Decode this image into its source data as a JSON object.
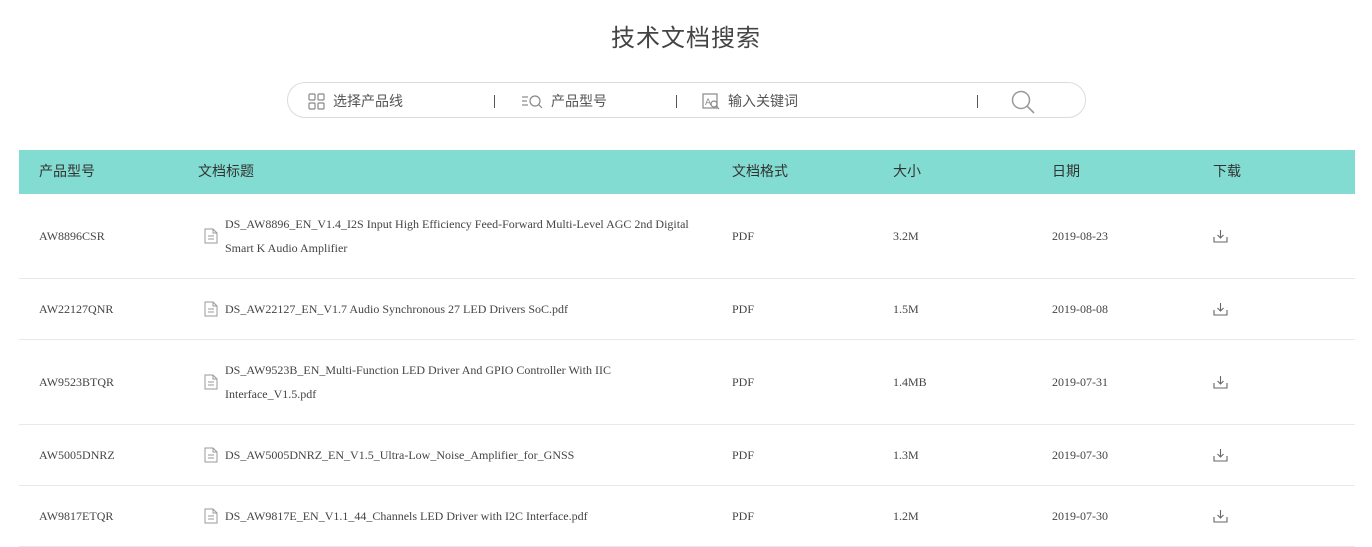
{
  "page": {
    "title": "技术文档搜索"
  },
  "search": {
    "product_line_label": "选择产品线",
    "model_label": "产品型号",
    "keyword_placeholder": "输入关键词",
    "product_line_icon": "grid-icon",
    "model_icon": "list-search-icon",
    "keyword_icon": "text-search-icon",
    "search_icon": "magnifier-icon"
  },
  "table": {
    "header_color": "#82dcd2",
    "columns": [
      "产品型号",
      "文档标题",
      "文档格式",
      "大小",
      "日期",
      "下载"
    ],
    "rows": [
      {
        "model": "AW8896CSR",
        "title": "DS_AW8896_EN_V1.4_I2S Input High Efficiency Feed-Forward Multi-Level AGC 2nd Digital Smart K Audio Amplifier",
        "format": "PDF",
        "size": "3.2M",
        "date": "2019-08-23"
      },
      {
        "model": "AW22127QNR",
        "title": "DS_AW22127_EN_V1.7 Audio Synchronous 27 LED Drivers SoC.pdf",
        "format": "PDF",
        "size": "1.5M",
        "date": "2019-08-08"
      },
      {
        "model": "AW9523BTQR",
        "title": "DS_AW9523B_EN_Multi-Function LED Driver And GPIO Controller With IIC Interface_V1.5.pdf",
        "format": "PDF",
        "size": "1.4MB",
        "date": "2019-07-31"
      },
      {
        "model": "AW5005DNRZ",
        "title": "DS_AW5005DNRZ_EN_V1.5_Ultra-Low_Noise_Amplifier_for_GNSS",
        "format": "PDF",
        "size": "1.3M",
        "date": "2019-07-30"
      },
      {
        "model": "AW9817ETQR",
        "title": "DS_AW9817E_EN_V1.1_44_Channels LED Driver with I2C Interface.pdf",
        "format": "PDF",
        "size": "1.2M",
        "date": "2019-07-30"
      }
    ]
  }
}
